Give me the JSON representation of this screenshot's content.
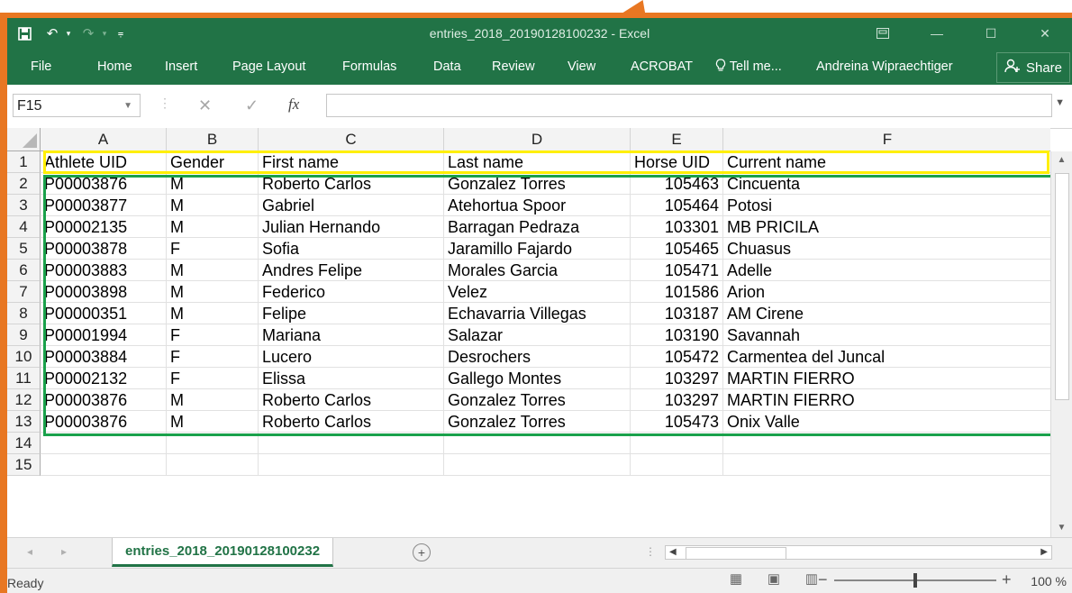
{
  "titlebar": {
    "title": "entries_2018_20190128100232 - Excel",
    "save_icon": "save-icon",
    "undo_icon": "undo-icon",
    "redo_icon": "redo-icon"
  },
  "ribbon": {
    "tabs": [
      "File",
      "Home",
      "Insert",
      "Page Layout",
      "Formulas",
      "Data",
      "Review",
      "View",
      "ACROBAT"
    ],
    "tell_me": "Tell me...",
    "user": "Andreina Wipraechtiger",
    "share": "Share"
  },
  "formula_bar": {
    "name_box": "F15",
    "fx": "fx",
    "value": ""
  },
  "sheet": {
    "columns": [
      "A",
      "B",
      "C",
      "D",
      "E",
      "F"
    ],
    "row_numbers": [
      "1",
      "2",
      "3",
      "4",
      "5",
      "6",
      "7",
      "8",
      "9",
      "10",
      "11",
      "12",
      "13",
      "14",
      "15"
    ],
    "headers": [
      "Athlete UID",
      "Gender",
      "First name",
      "Last name",
      "Horse UID",
      "Current name"
    ],
    "rows": [
      [
        "P00003876",
        "M",
        "Roberto Carlos",
        "Gonzalez Torres",
        "105463",
        "Cincuenta"
      ],
      [
        "P00003877",
        "M",
        "Gabriel",
        "Atehortua Spoor",
        "105464",
        "Potosi"
      ],
      [
        "P00002135",
        "M",
        "Julian Hernando",
        "Barragan Pedraza",
        "103301",
        "MB PRICILA"
      ],
      [
        "P00003878",
        "F",
        "Sofia",
        "Jaramillo Fajardo",
        "105465",
        "Chuasus"
      ],
      [
        "P00003883",
        "M",
        "Andres Felipe",
        "Morales Garcia",
        "105471",
        "Adelle"
      ],
      [
        "P00003898",
        "M",
        "Federico",
        "Velez",
        "101586",
        "Arion"
      ],
      [
        "P00000351",
        "M",
        "Felipe",
        "Echavarria Villegas",
        "103187",
        "AM Cirene"
      ],
      [
        "P00001994",
        "F",
        "Mariana",
        "Salazar",
        "103190",
        "Savannah"
      ],
      [
        "P00003884",
        "F",
        "Lucero",
        "Desrochers",
        "105472",
        "Carmentea del Juncal"
      ],
      [
        "P00002132",
        "F",
        "Elissa",
        "Gallego Montes",
        "103297",
        "MARTIN FIERRO"
      ],
      [
        "P00003876",
        "M",
        "Roberto Carlos",
        "Gonzalez Torres",
        "103297",
        "MARTIN FIERRO"
      ],
      [
        "P00003876",
        "M",
        "Roberto Carlos",
        "Gonzalez Torres",
        "105473",
        "Onix Valle"
      ]
    ],
    "highlight_colors": {
      "header": "#ffef00",
      "data": "#1aa14b"
    }
  },
  "sheet_tabs": {
    "active": "entries_2018_20190128100232"
  },
  "status": {
    "ready": "Ready",
    "zoom": "100 %"
  },
  "colors": {
    "excel_green": "#217346",
    "annotation_orange": "#e87722"
  }
}
